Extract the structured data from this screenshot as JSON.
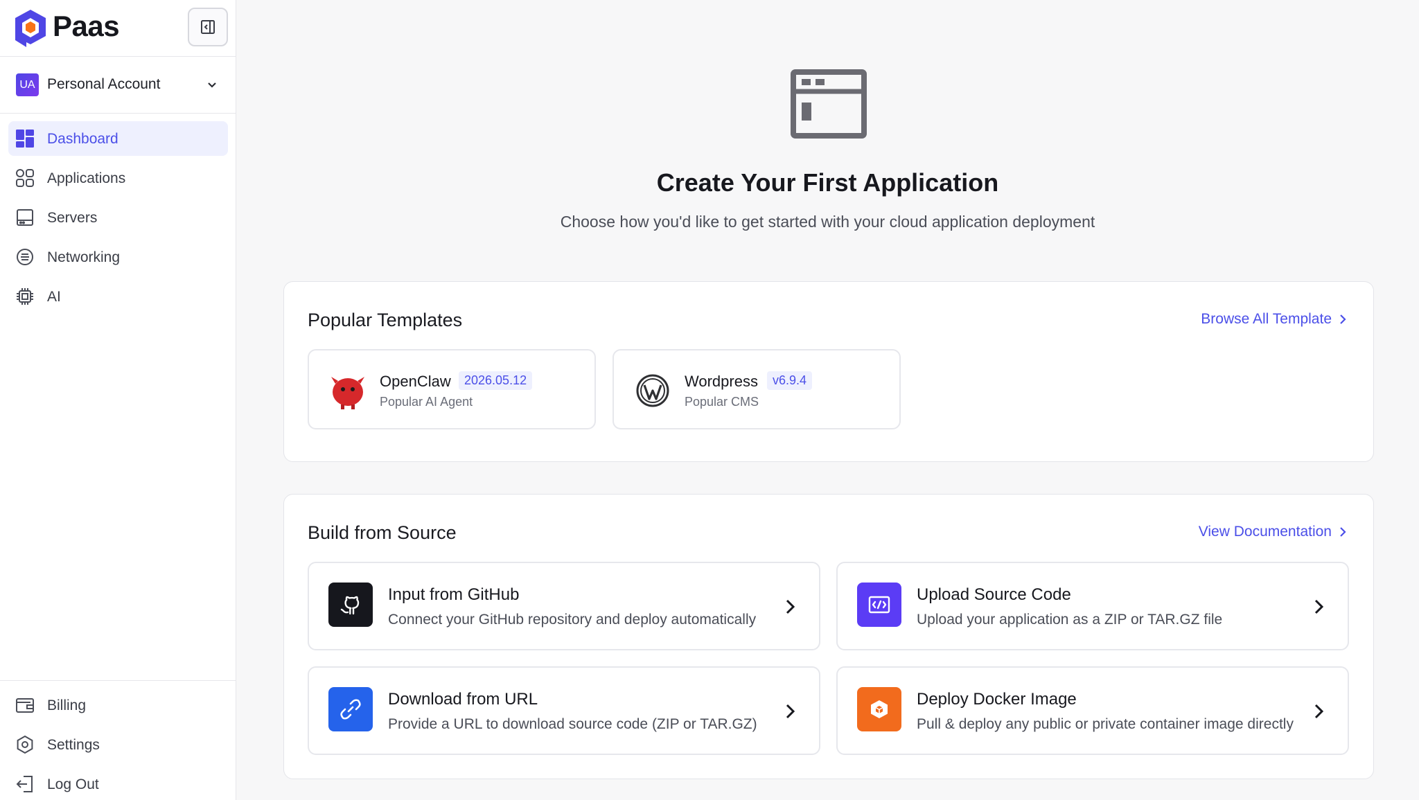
{
  "brand": {
    "name": "Paas"
  },
  "account": {
    "avatar_text": "UA",
    "name": "Personal Account"
  },
  "nav": [
    {
      "label": "Dashboard",
      "icon": "dashboard-icon",
      "active": true
    },
    {
      "label": "Applications",
      "icon": "apps-icon",
      "active": false
    },
    {
      "label": "Servers",
      "icon": "server-icon",
      "active": false
    },
    {
      "label": "Networking",
      "icon": "networking-icon",
      "active": false
    },
    {
      "label": "AI",
      "icon": "chip-icon",
      "active": false
    }
  ],
  "nav_bottom": [
    {
      "label": "Billing",
      "icon": "wallet-icon"
    },
    {
      "label": "Settings",
      "icon": "settings-icon"
    },
    {
      "label": "Log Out",
      "icon": "logout-icon"
    }
  ],
  "hero": {
    "title": "Create Your First Application",
    "subtitle": "Choose how you'd like to get started with your cloud application deployment"
  },
  "templates": {
    "title": "Popular Templates",
    "link": "Browse All Template",
    "items": [
      {
        "name": "OpenClaw",
        "version": "2026.05.12",
        "desc": "Popular AI Agent",
        "icon": "openclaw-icon"
      },
      {
        "name": "Wordpress",
        "version": "v6.9.4",
        "desc": "Popular CMS",
        "icon": "wordpress-icon"
      }
    ]
  },
  "source": {
    "title": "Build from Source",
    "link": "View Documentation",
    "items": [
      {
        "title": "Input from GitHub",
        "desc": "Connect your GitHub repository and deploy automatically",
        "icon": "github-icon",
        "color": "#16171d"
      },
      {
        "title": "Upload Source Code",
        "desc": "Upload your application as a ZIP or TAR.GZ file",
        "icon": "code-upload-icon",
        "color": "#5b3cf5"
      },
      {
        "title": "Download from URL",
        "desc": "Provide a URL to download source code (ZIP or TAR.GZ)",
        "icon": "link-icon",
        "color": "#2563eb"
      },
      {
        "title": "Deploy Docker Image",
        "desc": "Pull & deploy any public or private container image directly",
        "icon": "docker-box-icon",
        "color": "#f26b1d"
      }
    ]
  },
  "colors": {
    "accent": "#4b4fe8",
    "active_bg": "#eef0fe"
  }
}
